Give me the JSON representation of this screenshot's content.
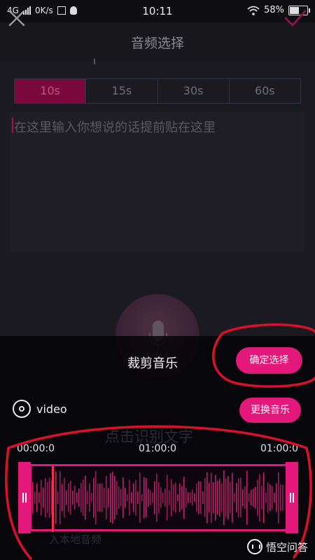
{
  "status_bar": {
    "network": "4G",
    "speed": "0K/s",
    "time": "10:11",
    "battery": "58%",
    "battery_level": 0.58
  },
  "header": {
    "title": "音频选择",
    "close_icon": "close-icon",
    "confirm_icon": "checkmark-icon"
  },
  "durations": [
    {
      "label": "10s",
      "active": true
    },
    {
      "label": "15s",
      "active": false
    },
    {
      "label": "30s",
      "active": false
    },
    {
      "label": "60s",
      "active": false
    }
  ],
  "text_input": {
    "placeholder": "在这里输入你想说的话提前贴在这里"
  },
  "background_hint": {
    "tap_to_recognize": "点击识别文字",
    "local_audio": "入本地音频"
  },
  "trim_panel": {
    "title": "裁剪音乐",
    "confirm_button": "确定选择",
    "change_music_button": "更换音乐",
    "music_name": "video",
    "time_start": "00:00:0",
    "time_mid": "01:00:0",
    "time_end": "01:00:0"
  },
  "watermark": {
    "text": "悟空问答"
  },
  "colors": {
    "accent": "#e3187a",
    "annotation_red": "#d8102a",
    "tab_active": "#7a0a3e"
  }
}
